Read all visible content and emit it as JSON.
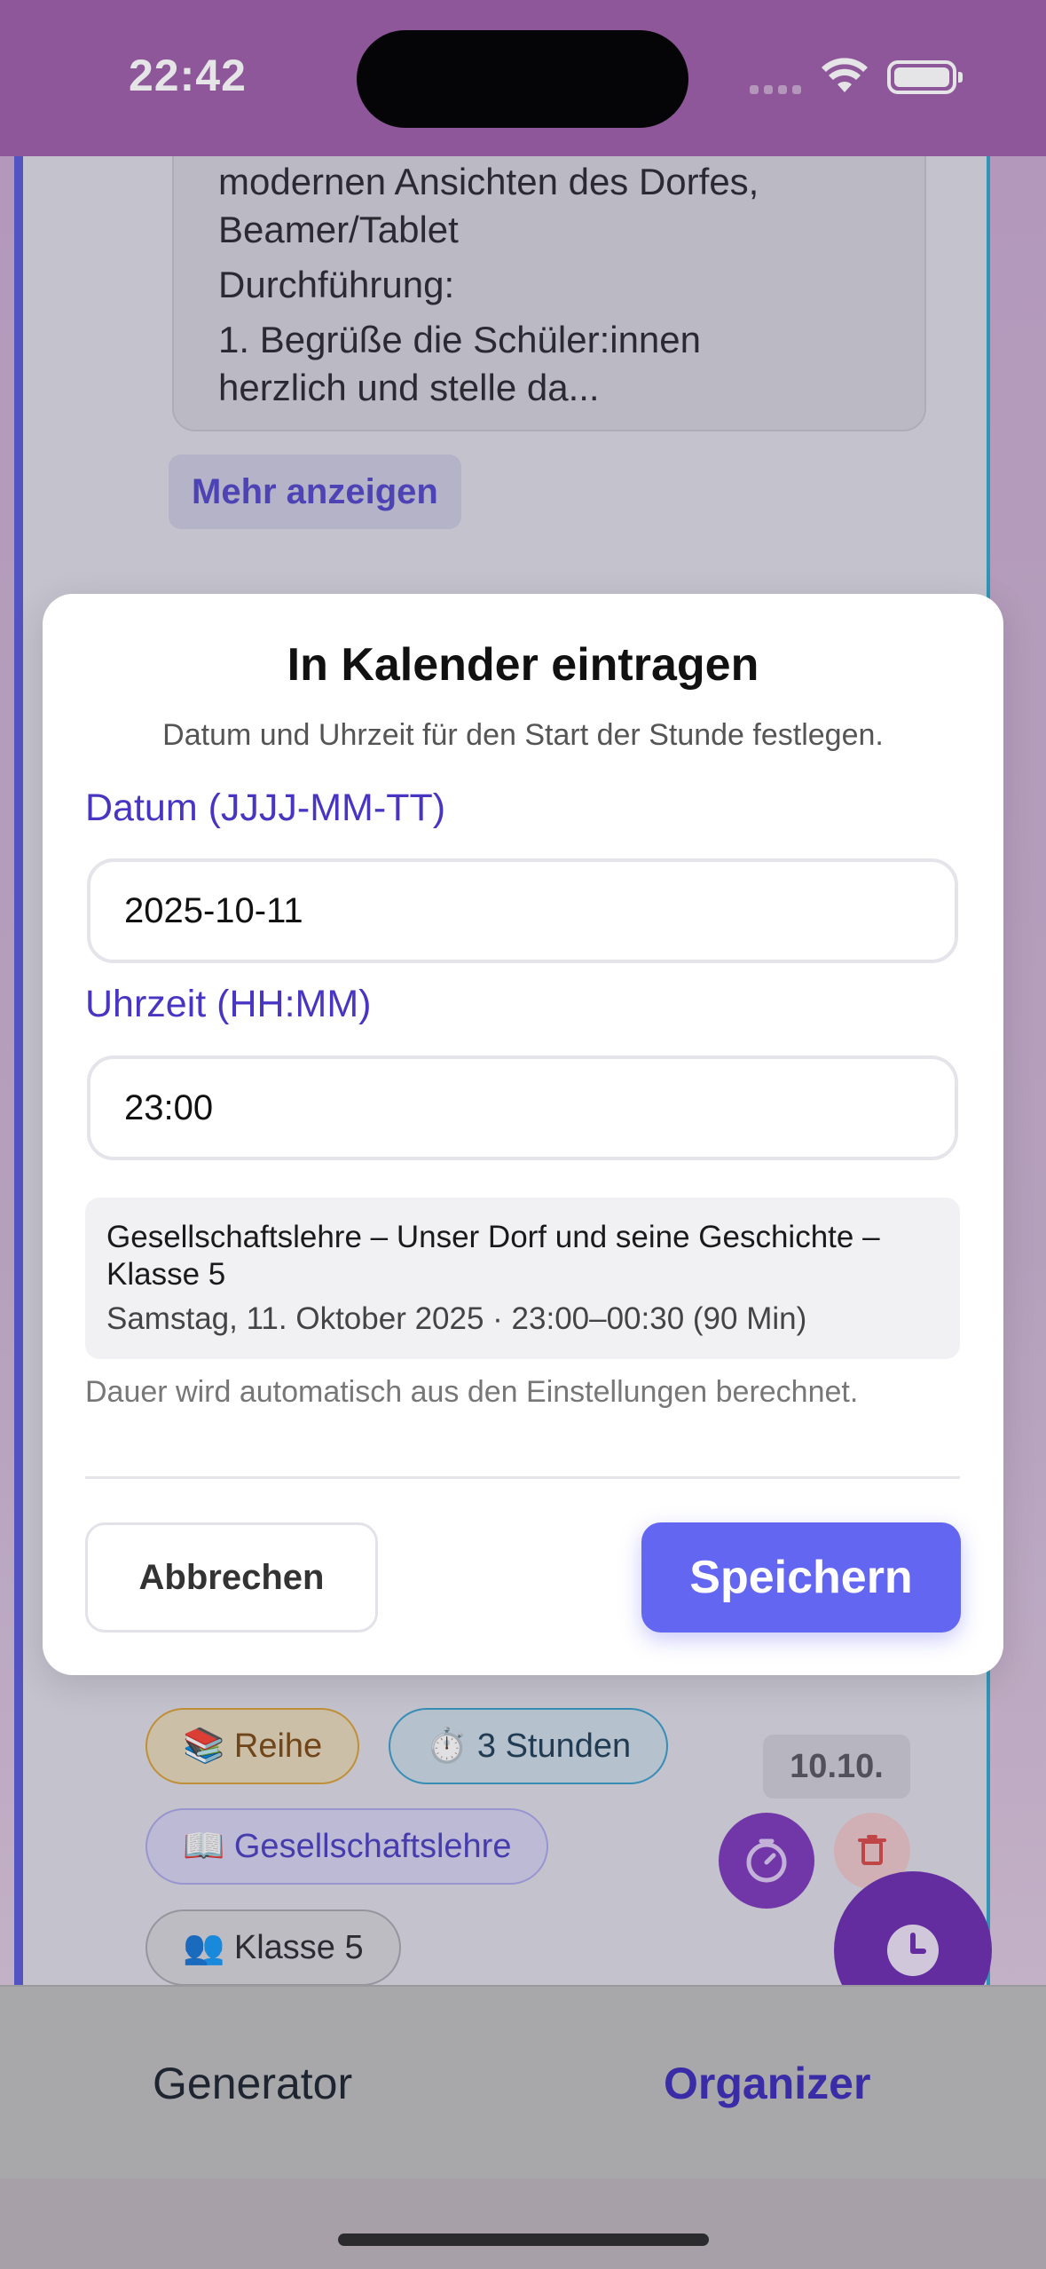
{
  "status_bar": {
    "time": "22:42"
  },
  "background_card": {
    "lines": [
      "modernen Ansichten des Dorfes,",
      "Beamer/Tablet",
      "Durchführung:",
      "1. Begrüße die Schüler:innen",
      "herzlich und stelle da..."
    ],
    "more_label": "Mehr anzeigen",
    "chips": {
      "reihe": "📚 Reihe",
      "stunden": "⏱️ 3 Stunden",
      "fach": "📖 Gesellschaftslehre",
      "klasse": "👥 Klasse 5"
    },
    "date_badge": "10.10."
  },
  "modal": {
    "title": "In Kalender eintragen",
    "subtitle": "Datum und Uhrzeit für den Start der Stunde festlegen.",
    "date_label": "Datum (JJJJ-MM-TT)",
    "date_value": "2025-10-11",
    "time_label": "Uhrzeit (HH:MM)",
    "time_value": "23:00",
    "summary_title": "Gesellschaftslehre – Unser Dorf und seine Geschichte – Klasse 5",
    "summary_meta": "Samstag, 11. Oktober 2025 · 23:00–00:30 (90 Min)",
    "note": "Dauer wird automatisch aus den Einstellungen berechnet.",
    "cancel_label": "Abbrechen",
    "save_label": "Speichern"
  },
  "tabs": {
    "generator": "Generator",
    "organizer": "Organizer"
  },
  "colors": {
    "accent": "#6366f1",
    "label_purple": "#4836c2",
    "status_bar_bg": "#9b5fa8",
    "fab_purple": "#6c2fb0"
  }
}
